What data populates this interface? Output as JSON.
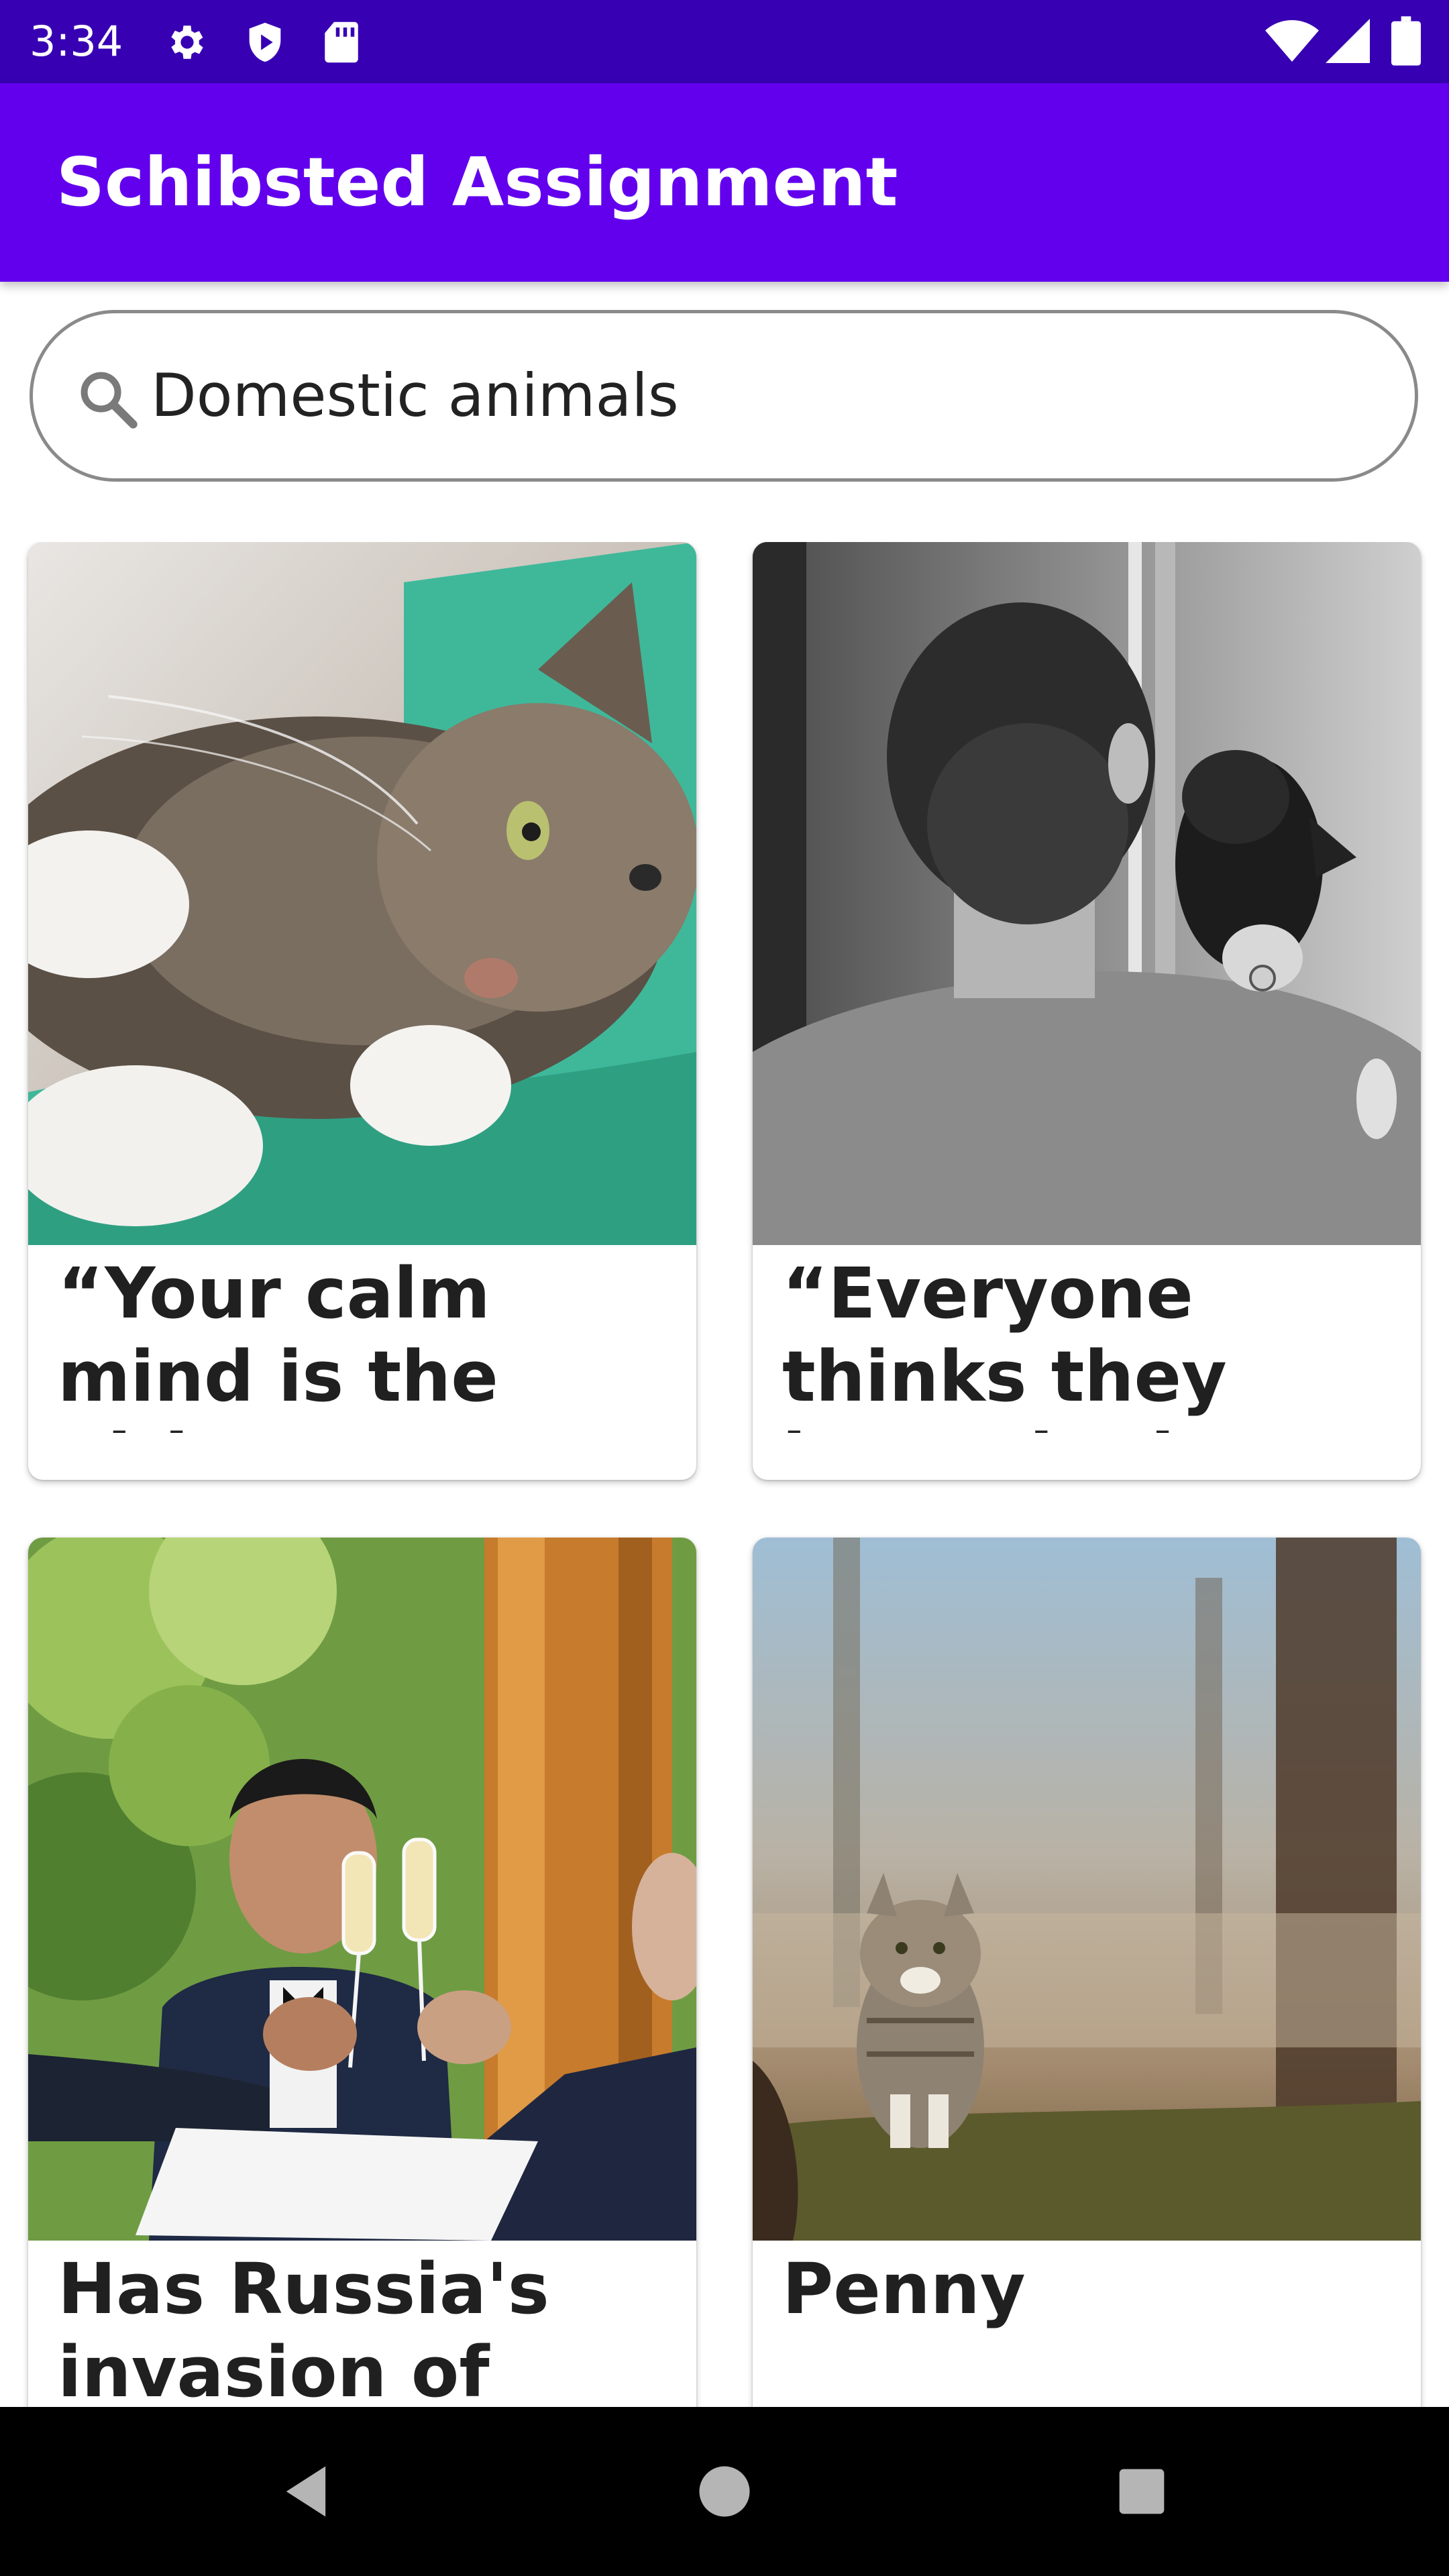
{
  "status_bar": {
    "time": "3:34",
    "icons_left": [
      "settings-gear-icon",
      "play-protect-icon",
      "sd-card-icon"
    ],
    "icons_right": [
      "wifi-icon",
      "signal-icon",
      "battery-icon"
    ]
  },
  "app_bar": {
    "title": "Schibsted Assignment"
  },
  "search": {
    "icon": "search-icon",
    "value": "Domestic animals"
  },
  "cards": [
    {
      "title": "“Your calm mind is the ultimate",
      "image": "cat-lying-on-blanket"
    },
    {
      "title": "“Everyone thinks they have the best",
      "image": "man-with-dog-on-shoulder"
    },
    {
      "title": "Has Russia's invasion of",
      "image": "waiter-with-champagne-glasses"
    },
    {
      "title": "Penny",
      "image": "cat-sitting-in-field"
    }
  ],
  "nav_bar": {
    "buttons": [
      "back-icon",
      "home-icon",
      "recents-icon"
    ]
  },
  "colors": {
    "status_bar": "#3700B3",
    "app_bar": "#6200EE",
    "nav_bar": "#000000"
  }
}
